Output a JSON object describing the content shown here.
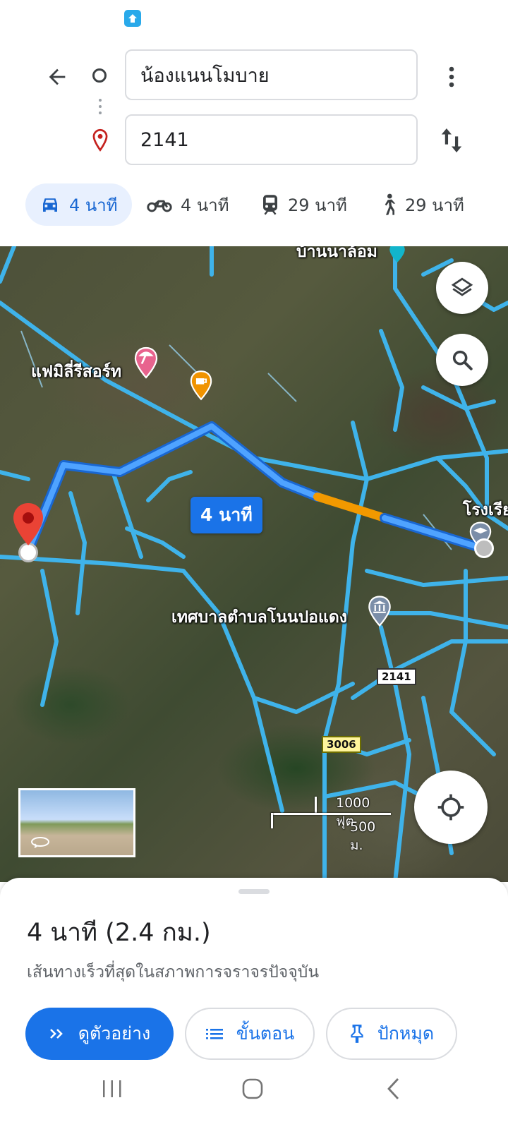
{
  "header": {
    "origin_value": "น้องแนนโมบาย",
    "destination_value": "2141"
  },
  "modes": [
    {
      "icon": "car-icon",
      "label": "4 นาที",
      "selected": true
    },
    {
      "icon": "motorcycle-icon",
      "label": "4 นาที",
      "selected": false
    },
    {
      "icon": "train-icon",
      "label": "29 นาที",
      "selected": false
    },
    {
      "icon": "walk-icon",
      "label": "29 นาที",
      "selected": false
    }
  ],
  "map": {
    "labels": {
      "village": "บ้านนาล้อม",
      "resort": "แฟมิลี่รีสอร์ท",
      "school": "โรงเรีย",
      "municipality": "เทศบาลตำบลโนนปอแดง"
    },
    "route_badge": "4 นาที",
    "road_shields": [
      "2141",
      "3006"
    ],
    "scale": {
      "imperial": "1000 ฟุต",
      "metric": "500 ม."
    }
  },
  "sheet": {
    "summary": "4 นาที (2.4 กม.)",
    "subtitle": "เส้นทางเร็วที่สุดในสภาพการจราจรปัจจุบัน",
    "buttons": {
      "preview": "ดูตัวอย่าง",
      "steps": "ขั้นตอน",
      "pin": "ปักหมุด"
    }
  },
  "colors": {
    "route": "#1a73e8",
    "traffic": "#f29900",
    "roads": "#3fb3ea",
    "pin": "#ea4335"
  }
}
